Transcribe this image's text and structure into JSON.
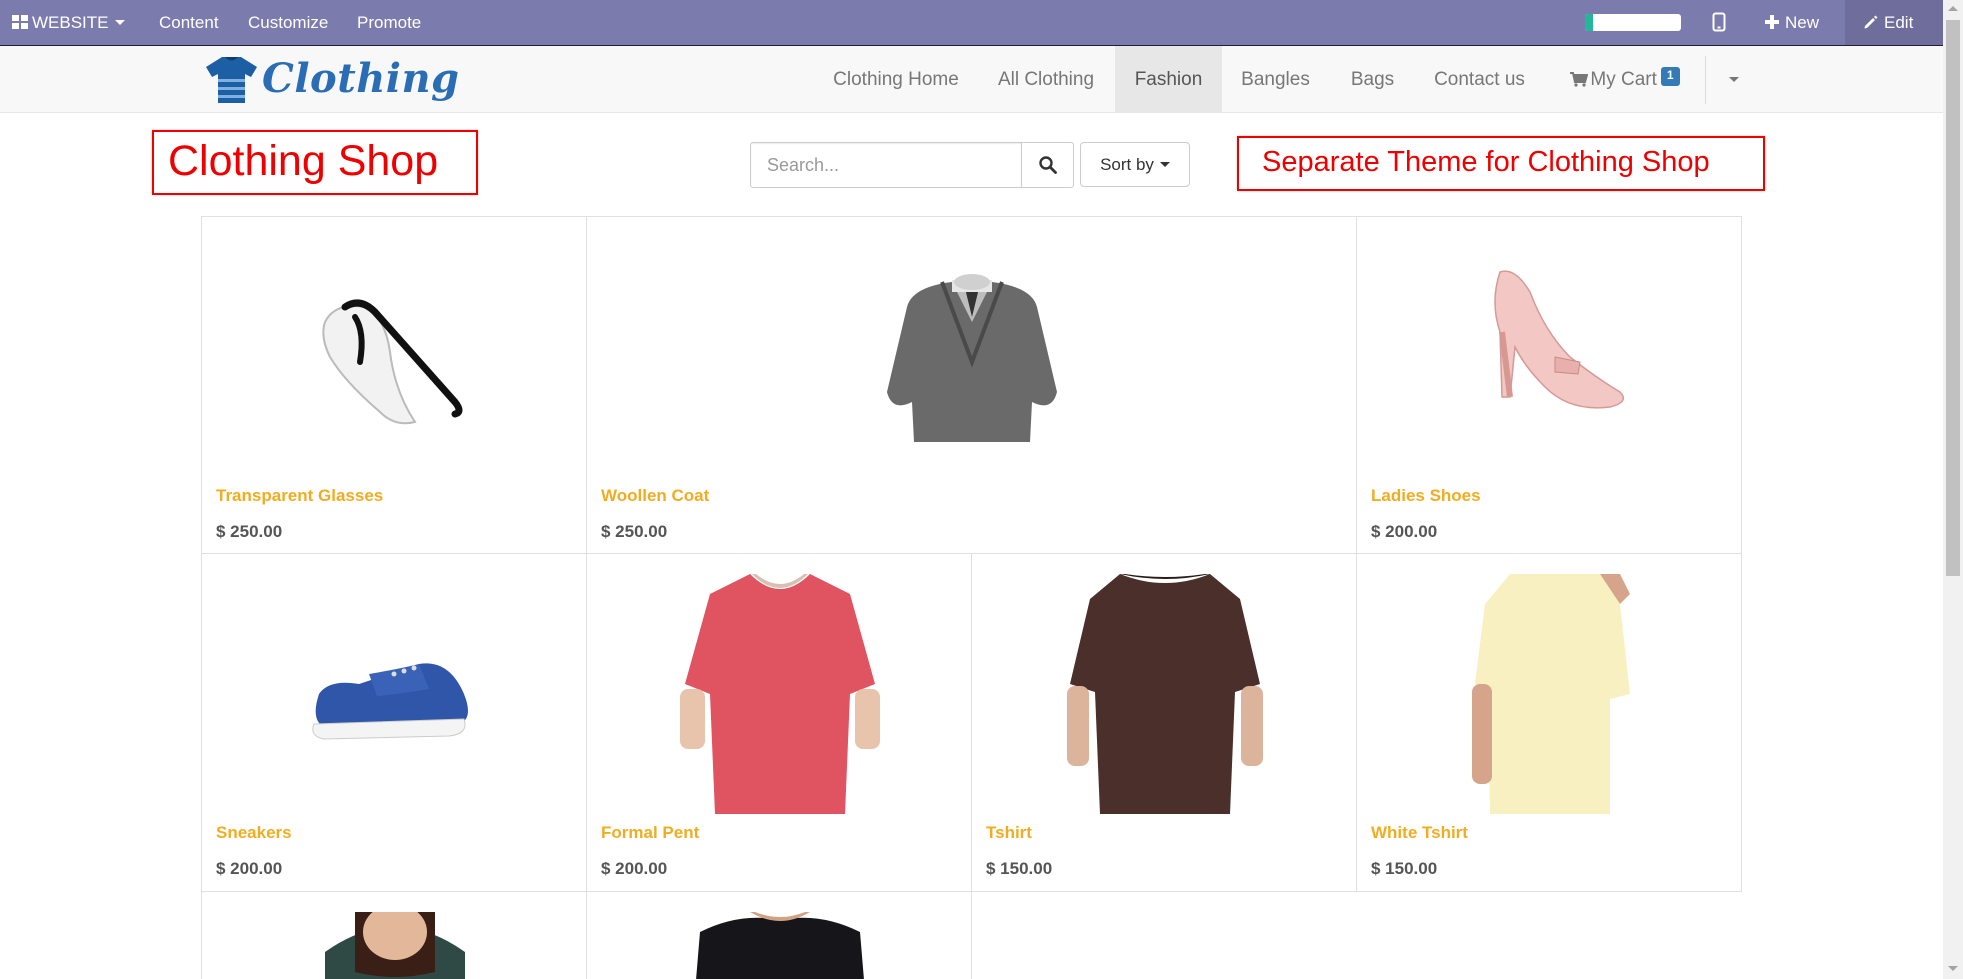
{
  "adminbar": {
    "website_menu": "WEBSITE",
    "content": "Content",
    "customize": "Customize",
    "promote": "Promote",
    "progress": 0.08,
    "new_label": "New",
    "edit_label": "Edit"
  },
  "navbar": {
    "logo_text": "Clothing",
    "links": [
      "Clothing Home",
      "All Clothing",
      "Fashion",
      "Bangles",
      "Bags",
      "Contact us"
    ],
    "active_link": "Fashion",
    "cart_label": "My Cart",
    "cart_count": "1"
  },
  "annotations": {
    "shop_title": "Clothing Shop",
    "theme_note": "Separate Theme for Clothing Shop"
  },
  "search": {
    "placeholder": "Search...",
    "sort_label": "Sort by"
  },
  "products": [
    {
      "name": "Transparent Glasses",
      "price": "$ 250.00",
      "image": "glasses"
    },
    {
      "name": "Woollen Coat",
      "price": "$ 250.00",
      "image": "coat"
    },
    {
      "name": "Ladies Shoes",
      "price": "$ 200.00",
      "image": "pink-heel"
    },
    {
      "name": "Sneakers",
      "price": "$ 200.00",
      "image": "blue-sneaker"
    },
    {
      "name": "Formal Pent",
      "price": "$ 200.00",
      "image": "red-tshirt"
    },
    {
      "name": "Tshirt",
      "price": "$ 150.00",
      "image": "brown-tshirt"
    },
    {
      "name": "White Tshirt",
      "price": "$ 150.00",
      "image": "cream-tshirt"
    },
    {
      "name": "",
      "price": "",
      "image": "woman-green-top"
    },
    {
      "name": "",
      "price": "",
      "image": "man-black-tshirt"
    }
  ],
  "colors": {
    "adminbar": "#7c7bad",
    "product_name": "#f0ad22",
    "annotation": "#ee0000",
    "badge": "#337ab7"
  }
}
